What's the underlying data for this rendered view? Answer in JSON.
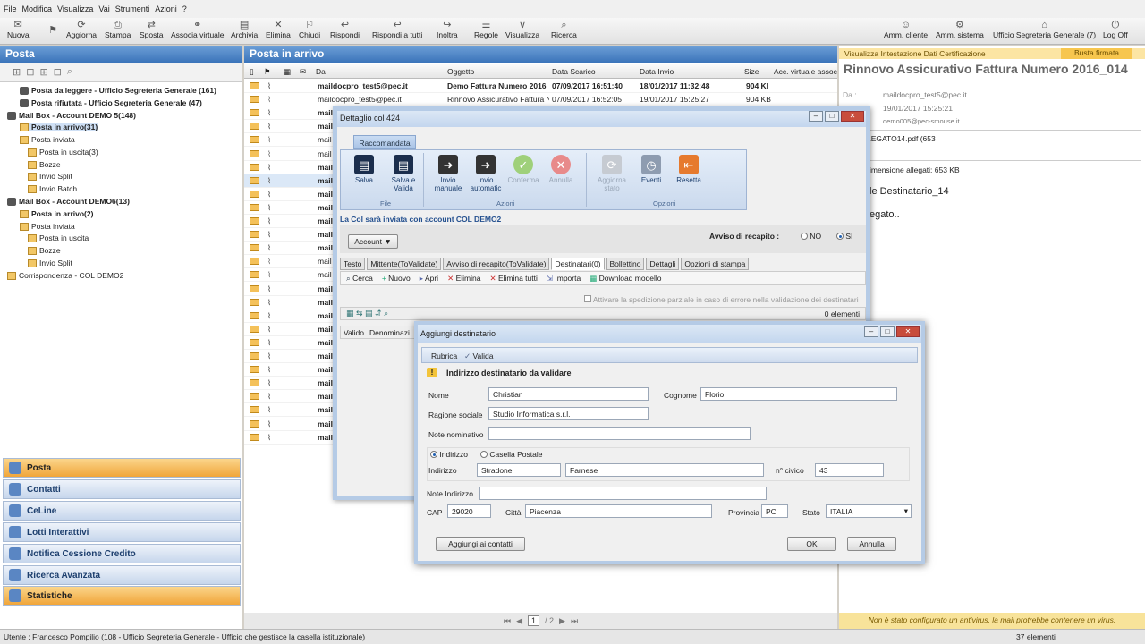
{
  "menu": [
    "File",
    "Modifica",
    "Visualizza",
    "Vai",
    "Strumenti",
    "Azioni",
    "?"
  ],
  "toolbar_left": [
    "Nuova",
    "Aggiorna",
    "Stampa",
    "Sposta",
    "Associa virtuale",
    "Archivia",
    "Elimina",
    "Chiudi",
    "Rispondi",
    "Rispondi a tutti",
    "Inoltra",
    "Regole",
    "Visualizza",
    "Ricerca"
  ],
  "toolbar_right": [
    "Amm. cliente",
    "Amm. sistema",
    "Ufficio Segreteria Generale (7)",
    "Log Off"
  ],
  "left": {
    "title": "Posta",
    "tree": [
      {
        "label": "Posta da leggere - Ufficio Segreteria Generale (161)",
        "bold": true
      },
      {
        "label": "Posta rifiutata - Ufficio Segreteria Generale (47)",
        "bold": true
      },
      {
        "label": "Mail Box - Account DEMO 5(148)",
        "bold": true
      },
      {
        "label": "Posta in arrivo(31)",
        "bold": true
      },
      {
        "label": "Posta inviata",
        "bold": false
      },
      {
        "label": "Posta in uscita(3)",
        "bold": false
      },
      {
        "label": "Bozze",
        "bold": false
      },
      {
        "label": "Invio Split",
        "bold": false
      },
      {
        "label": "Invio Batch",
        "bold": false
      },
      {
        "label": "Mail Box - Account DEMO6(13)",
        "bold": true
      },
      {
        "label": "Posta in arrivo(2)",
        "bold": true
      },
      {
        "label": "Posta inviata",
        "bold": false
      },
      {
        "label": "Posta in uscita",
        "bold": false
      },
      {
        "label": "Bozze",
        "bold": false
      },
      {
        "label": "Invio Split",
        "bold": false
      },
      {
        "label": "Corrispondenza - COL DEMO2",
        "bold": false
      }
    ],
    "nav": [
      "Posta",
      "Contatti",
      "CeLine",
      "Lotti Interattivi",
      "Notifica Cessione Credito",
      "Ricerca Avanzata",
      "Statistiche"
    ]
  },
  "middle": {
    "title": "Posta in arrivo",
    "columns": [
      "Da",
      "Oggetto",
      "Data Scarico",
      "Data Invio",
      "Size",
      "Acc. virtuale assoc"
    ],
    "rows": [
      {
        "from": "maildocpro_test5@pec.it",
        "subject": "Demo Fattura Numero 2016",
        "scarico": "07/09/2017 16:51:40",
        "invio": "18/01/2017 11:32:48",
        "size": "904 KI",
        "bold": true
      },
      {
        "from": "maildocpro_test5@pec.it",
        "subject": "Rinnovo Assicurativo Fattura N",
        "scarico": "07/09/2017 16:52:05",
        "invio": "19/01/2017 15:25:27",
        "size": "904 KB",
        "bold": false
      },
      {
        "from": "mail",
        "bold": true
      },
      {
        "from": "mail",
        "bold": true
      },
      {
        "from": "mail",
        "bold": false
      },
      {
        "from": "mail",
        "bold": false
      },
      {
        "from": "mail",
        "bold": true
      },
      {
        "from": "mail",
        "bold": true
      },
      {
        "from": "mail",
        "bold": true
      },
      {
        "from": "mail",
        "bold": true
      },
      {
        "from": "mail",
        "bold": true
      },
      {
        "from": "mail",
        "bold": true
      },
      {
        "from": "mail",
        "bold": true
      },
      {
        "from": "mail",
        "bold": false
      },
      {
        "from": "mail",
        "bold": false
      },
      {
        "from": "mail",
        "bold": true
      },
      {
        "from": "mail",
        "bold": true
      },
      {
        "from": "mail",
        "bold": true
      },
      {
        "from": "mail",
        "bold": true
      },
      {
        "from": "mail",
        "bold": true
      },
      {
        "from": "mail",
        "bold": true
      },
      {
        "from": "mail",
        "bold": true
      },
      {
        "from": "mail",
        "bold": true
      },
      {
        "from": "mail",
        "bold": true
      },
      {
        "from": "mail",
        "bold": true
      },
      {
        "from": "mail",
        "bold": true
      },
      {
        "from": "mail",
        "bold": true
      }
    ],
    "pager": {
      "current": "1",
      "total": "/ 2"
    }
  },
  "right": {
    "banner": "Visualizza Intestazione Dati Certificazione",
    "badge": "Busta firmata",
    "title": "Rinnovo Assicurativo Fattura Numero 2016_014",
    "da_label": "Da :",
    "from": "maildocpro_test5@pec.it",
    "date": "19/01/2017 15:25:21",
    "to": "demo005@pec-smouse.it",
    "attachment": "LEGATO14.pdf (653",
    "attach_size": "imensione allegati: 653 KB",
    "body1": "le Destinatario_14",
    "body2": "egato..",
    "warning": "Non è stato configurato un antivirus, la mail protrebbe contenere un virus."
  },
  "status": {
    "user": "Utente : Francesco Pompilio (108 - Ufficio Segreteria Generale - Ufficio che gestisce la casella istituzionale)",
    "count": "37 elementi"
  },
  "dlg1": {
    "title": "Dettaglio col 424",
    "ribbon_tab": "Raccomandata",
    "buttons": [
      "Salva",
      "Salva e Valida",
      "Invio manuale",
      "Invio automatic",
      "Conferma",
      "Annulla",
      "Aggiorna stato",
      "Eventi",
      "Resetta"
    ],
    "groups": [
      "File",
      "Azioni",
      "Opzioni"
    ],
    "info": "La Col sarà inviata con account COL DEMO2",
    "account": "Account ▼",
    "avviso": "Avviso di recapito :",
    "no": "NO",
    "si": "SI",
    "tabs": [
      "Testo",
      "Mittente(ToValidate)",
      "Avviso di recapito(ToValidate)",
      "Destinatari(0)",
      "Bollettino",
      "Dettagli",
      "Opzioni di stampa"
    ],
    "tools": [
      "Cerca",
      "Nuovo",
      "Apri",
      "Elimina",
      "Elimina tutti",
      "Importa",
      "Download modello"
    ],
    "checkbox": "Attivare la spedizione parziale in caso di errore nella validazione dei destinatari",
    "elements": "0 elementi",
    "col_valido": "Valido",
    "col_denom": "Denominazi"
  },
  "dlg2": {
    "title": "Aggiungi destinatario",
    "rubrica": "Rubrica",
    "valida": "Valida",
    "warning": "Indirizzo destinatario da validare",
    "labels": {
      "nome": "Nome",
      "cognome": "Cognome",
      "ragione": "Ragione sociale",
      "note_nom": "Note nominativo",
      "indirizzo_radio": "Indirizzo",
      "casella": "Casella Postale",
      "indirizzo": "Indirizzo",
      "civico": "n° civico",
      "note_ind": "Note Indirizzo",
      "cap": "CAP",
      "citta": "Città",
      "provincia": "Provincia",
      "stato": "Stato"
    },
    "values": {
      "nome": "Christian",
      "cognome": "Florio",
      "ragione": "Studio Informatica s.r.l.",
      "note_nom": "",
      "via1": "Stradone",
      "via2": "Farnese",
      "civico": "43",
      "note_ind": "",
      "cap": "29020",
      "citta": "Piacenza",
      "provincia": "PC",
      "stato": "ITALIA"
    },
    "btn_add": "Aggiungi ai contatti",
    "btn_ok": "OK",
    "btn_cancel": "Annulla"
  }
}
